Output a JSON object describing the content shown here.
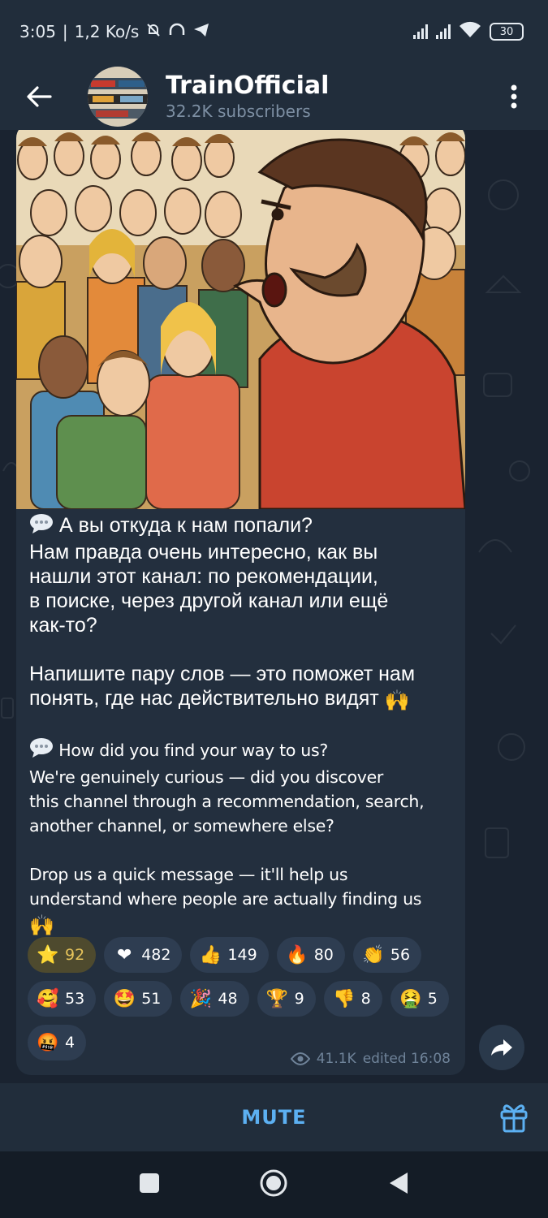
{
  "status_bar": {
    "time": "3:05",
    "network_speed": "1,2 Ko/s",
    "battery": "30",
    "icons": [
      "mute-bell-icon",
      "headphones-icon",
      "telegram-icon",
      "signal-icon",
      "signal-icon",
      "wifi-icon",
      "battery-icon"
    ]
  },
  "header": {
    "channel_name": "TrainOfficial",
    "subscribers": "32.2K subscribers",
    "back_icon": "arrow-left-icon",
    "menu_icon": "more-vertical-icon"
  },
  "message": {
    "ru_line1": "А вы откуда к нам попали?",
    "ru_line2": "Нам правда очень интересно, как вы",
    "ru_line3": "нашли этот канал: по рекомендации,",
    "ru_line4": "в поиске, через другой канал или ещё",
    "ru_line5": "как-то?",
    "ru_line6": "Напишите пару слов — это поможет нам",
    "ru_line7": "понять, где нас действительно видят",
    "en_line1": "How did you find your way to us?",
    "en_line2": "We're genuinely curious — did you discover",
    "en_line3": "this channel through a recommendation, search,",
    "en_line4": "another channel, or somewhere else?",
    "en_line5": "Drop us a quick message — it'll help us",
    "en_line6": "understand where people are actually finding us"
  },
  "reactions": [
    {
      "emoji": "⭐",
      "icon": "star-icon",
      "count": "92",
      "active": true
    },
    {
      "emoji": "❤",
      "icon": "heart-icon",
      "count": "482"
    },
    {
      "emoji": "👍",
      "icon": "thumbs-up-icon",
      "count": "149"
    },
    {
      "emoji": "🔥",
      "icon": "fire-icon",
      "count": "80"
    },
    {
      "emoji": "👏",
      "icon": "clapping-icon",
      "count": "56"
    },
    {
      "emoji": "🥰",
      "icon": "smiling-hearts-icon",
      "count": "53"
    },
    {
      "emoji": "🤩",
      "icon": "star-struck-icon",
      "count": "51"
    },
    {
      "emoji": "🎉",
      "icon": "party-popper-icon",
      "count": "48"
    },
    {
      "emoji": "🏆",
      "icon": "trophy-icon",
      "count": "9"
    },
    {
      "emoji": "👎",
      "icon": "thumbs-down-icon",
      "count": "8"
    },
    {
      "emoji": "🤮",
      "icon": "vomiting-icon",
      "count": "5"
    },
    {
      "emoji": "🤬",
      "icon": "cursing-icon",
      "count": "4"
    }
  ],
  "meta": {
    "views": "41.1K",
    "edited": "edited 16:08"
  },
  "bottom": {
    "mute_label": "MUTE"
  },
  "colors": {
    "accent": "#5cb0f2",
    "header_bg": "#212d3b",
    "bubble_bg": "#232f3e",
    "chat_bg": "#1a2330"
  }
}
